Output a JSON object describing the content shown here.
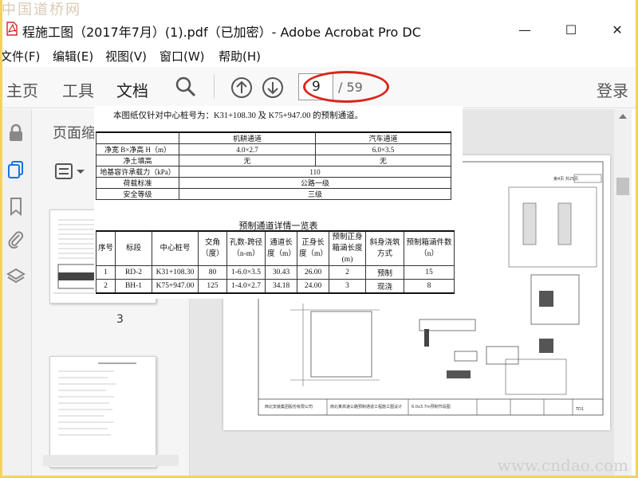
{
  "watermark_top": "中国道桥网",
  "watermark_bottom": "www.cndao.com",
  "window": {
    "title": "程施工图（2017年7月）(1).pdf（已加密）- Adobe Acrobat Pro DC",
    "minimize": "—",
    "maximize": "☐",
    "close": "✕"
  },
  "menu": {
    "items": [
      "文件(F)",
      "编辑(E)",
      "视图(V)",
      "窗口(W)",
      "帮助(H)"
    ]
  },
  "toolbar": {
    "tabs": [
      "主页",
      "工具",
      "文档"
    ],
    "current_page": "9",
    "total_pages": "/ 59",
    "login": "登录"
  },
  "thumbnails": {
    "title": "页面缩",
    "page_label": "3"
  },
  "overlay": {
    "note": "本图纸仅针对中心桩号为：K31+108.30 及 K75+947.00 的预制通道。",
    "table1": {
      "headers": [
        "",
        "机耕通道",
        "汽车通道"
      ],
      "rows": [
        {
          "label": "净宽 B×净高 H（m）",
          "a": "4.0×2.7",
          "b": "6.0×3.5"
        },
        {
          "label": "净土填高",
          "a": "无",
          "b": "无"
        },
        {
          "label": "地基容许承载力（kPa）",
          "span": "110"
        },
        {
          "label": "荷载标准",
          "span": "公路一级"
        },
        {
          "label": "安全等级",
          "span": "三级"
        }
      ]
    },
    "table2": {
      "caption": "预制通道详情一览表",
      "headers": [
        "序号",
        "标段",
        "中心桩号",
        "交角（度）",
        "孔数-跨径（n-m）",
        "通道长度（m）",
        "正身长度（m）",
        "预制正身箱涵长度(m)",
        "斜身浇筑方式",
        "预制箱涵件数（n）"
      ],
      "rows": [
        [
          "1",
          "RD-2",
          "K31+108.30",
          "80",
          "1-6.0×3.5",
          "30.43",
          "26.00",
          "2",
          "预制",
          "15"
        ],
        [
          "2",
          "BH-1",
          "K75+947.00",
          "125",
          "1-4.0×2.7",
          "34.18",
          "24.00",
          "3",
          "现浇",
          "8"
        ]
      ]
    }
  },
  "drawing": {
    "sheet_no": "第4页 共25页",
    "company": "西北安装集团股份有限公司",
    "project": "南北某高速公路预制通道工程施工图设计",
    "sheet_title": "6.0x3.7m预制节段图",
    "sheet_code": "TD1"
  },
  "colors": {
    "highlight": "#d8261c",
    "frame": "#f3d35a",
    "active": "#1473e6"
  }
}
